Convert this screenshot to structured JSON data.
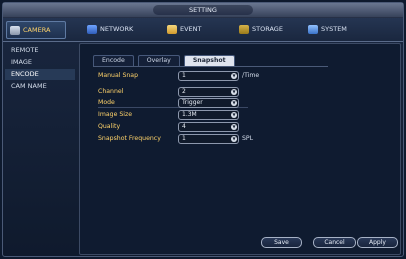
{
  "window": {
    "title": "SETTING"
  },
  "topnav": {
    "tabs": [
      {
        "label": "CAMERA",
        "active": true,
        "icon": "camera-icon"
      },
      {
        "label": "NETWORK",
        "active": false,
        "icon": "network-icon"
      },
      {
        "label": "EVENT",
        "active": false,
        "icon": "event-icon"
      },
      {
        "label": "STORAGE",
        "active": false,
        "icon": "storage-icon"
      },
      {
        "label": "SYSTEM",
        "active": false,
        "icon": "system-icon"
      }
    ]
  },
  "sidebar": {
    "items": [
      {
        "label": "REMOTE",
        "active": false
      },
      {
        "label": "IMAGE",
        "active": false
      },
      {
        "label": "ENCODE",
        "active": true
      },
      {
        "label": "CAM NAME",
        "active": false
      }
    ]
  },
  "subtabs": [
    {
      "label": "Encode",
      "active": false
    },
    {
      "label": "Overlay",
      "active": false
    },
    {
      "label": "Snapshot",
      "active": true
    }
  ],
  "form": {
    "manual_snap": {
      "label": "Manual Snap",
      "value": "1",
      "unit": "/Time"
    },
    "channel": {
      "label": "Channel",
      "value": "2"
    },
    "mode": {
      "label": "Mode",
      "value": "Trigger"
    },
    "image_size": {
      "label": "Image Size",
      "value": "1.3M"
    },
    "quality": {
      "label": "Quality",
      "value": "4"
    },
    "snapshot_frequency": {
      "label": "Snapshot Frequency",
      "value": "1",
      "unit": "SPL"
    }
  },
  "buttons": {
    "save": "Save",
    "cancel": "Cancel",
    "apply": "Apply"
  },
  "colors": {
    "accent": "#ffd36a",
    "background": "#0f1b30"
  }
}
